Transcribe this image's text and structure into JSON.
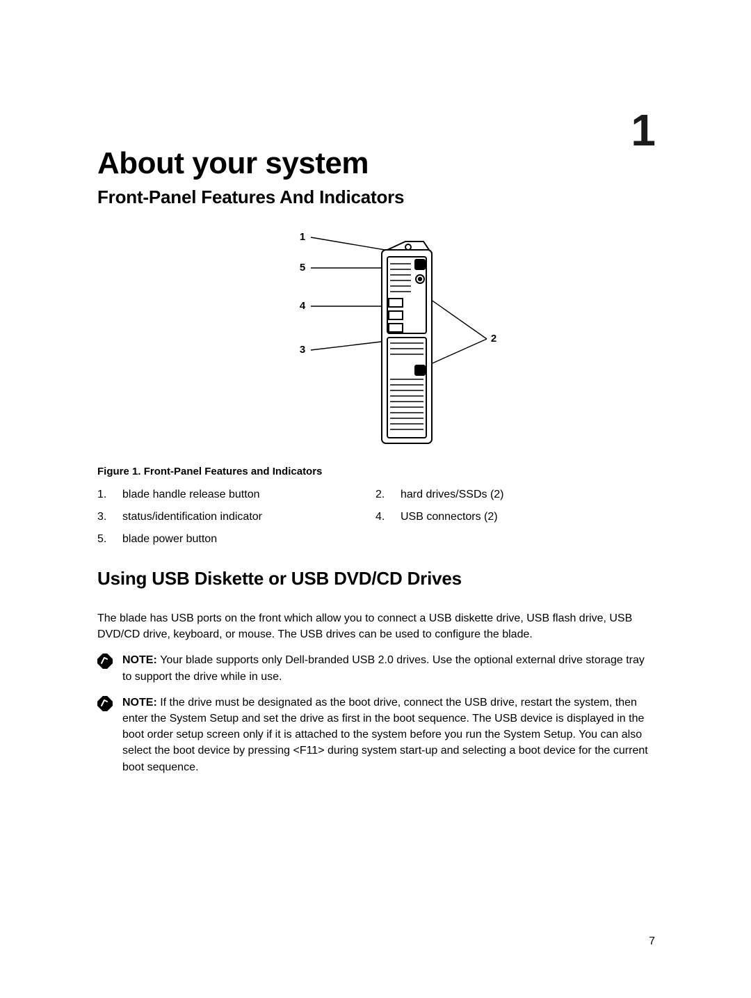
{
  "chapter": {
    "number": "1",
    "title": "About your system"
  },
  "sections": {
    "front_panel_title": "Front-Panel Features And Indicators",
    "usb_title": "Using USB Diskette or USB DVD/CD Drives"
  },
  "figure": {
    "caption_label": "Figure 1. ",
    "caption_text": "Front-Panel Features and Indicators",
    "callouts": {
      "c1": "1",
      "c2": "2",
      "c3": "3",
      "c4": "4",
      "c5": "5"
    }
  },
  "legend": {
    "n1": "1.",
    "t1": "blade handle release button",
    "n2": "2.",
    "t2": "hard drives/SSDs (2)",
    "n3": "3.",
    "t3": "status/identification indicator",
    "n4": "4.",
    "t4": "USB connectors (2)",
    "n5": "5.",
    "t5": "blade power button"
  },
  "paragraphs": {
    "usb_intro": "The blade has USB ports on the front which allow you to connect a USB diskette drive, USB flash drive, USB DVD/CD drive, keyboard, or mouse. The USB drives can be used to configure the blade."
  },
  "notes": {
    "label": "NOTE: ",
    "note1": "Your blade supports only Dell-branded USB 2.0 drives. Use the optional external drive storage tray to support the drive while in use.",
    "note2": "If the drive must be designated as the boot drive, connect the USB drive, restart the system, then enter the System Setup and set the drive as first in the boot sequence. The USB device is displayed in the boot order setup screen only if it is attached to the system before you run the System Setup. You can also select the boot device by pressing <F11> during system start-up and selecting a boot device for the current boot sequence."
  },
  "page_number": "7"
}
